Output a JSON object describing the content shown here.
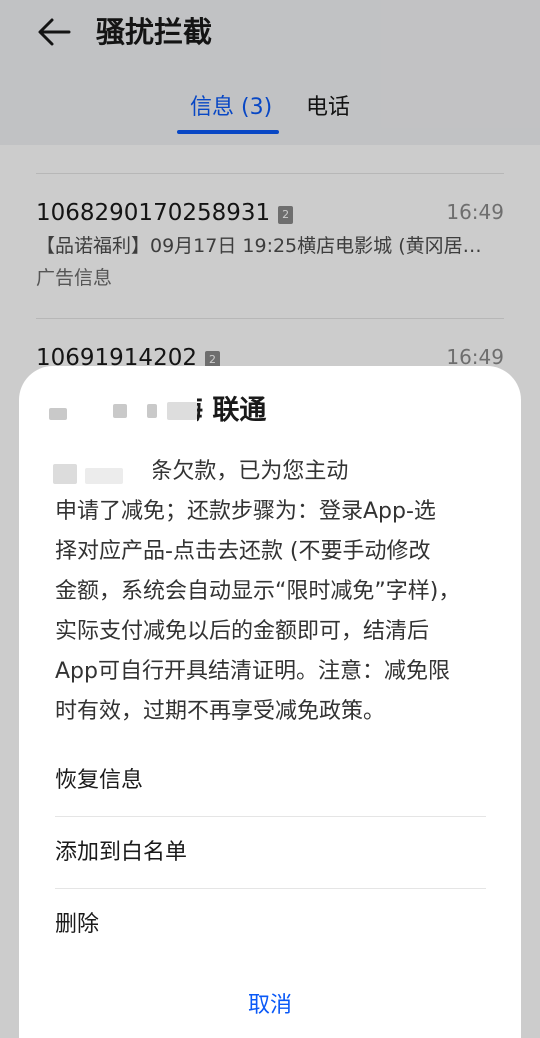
{
  "header": {
    "title": "骚扰拦截",
    "back_icon": "arrow-left-icon"
  },
  "tabs": [
    {
      "label": "信息 (3)",
      "active": true
    },
    {
      "label": "电话",
      "active": false
    }
  ],
  "messages": [
    {
      "number": "1068290170258931",
      "sim": "2",
      "time": "16:49",
      "preview": "【品诺福利】09月17日 19:25横店电影城 (黄冈居…",
      "tag": "广告信息"
    },
    {
      "number": "10691914202",
      "sim": "2",
      "time": "16:49"
    }
  ],
  "dialog": {
    "title_visible": "1      040 上海 联通",
    "body_lines": [
      "      您的金/白条欠款，已为您主动",
      "申请了减免；还款步骤为：登录App-选",
      "择对应产品-点击去还款 (不要手动修改",
      "金额，系统会自动显示“限时减免”字样)，",
      "实际支付减免以后的金额即可，结清后",
      "App可自行开具结清证明。注意：减免限",
      "时有效，过期不再享受减免政策。"
    ],
    "actions": [
      "恢复信息",
      "添加到白名单",
      "删除"
    ],
    "cancel": "取消"
  },
  "colors": {
    "accent": "#0a59f7",
    "header_bg": "#f2f3f5",
    "scrim": "rgba(0,0,0,0.2)"
  }
}
